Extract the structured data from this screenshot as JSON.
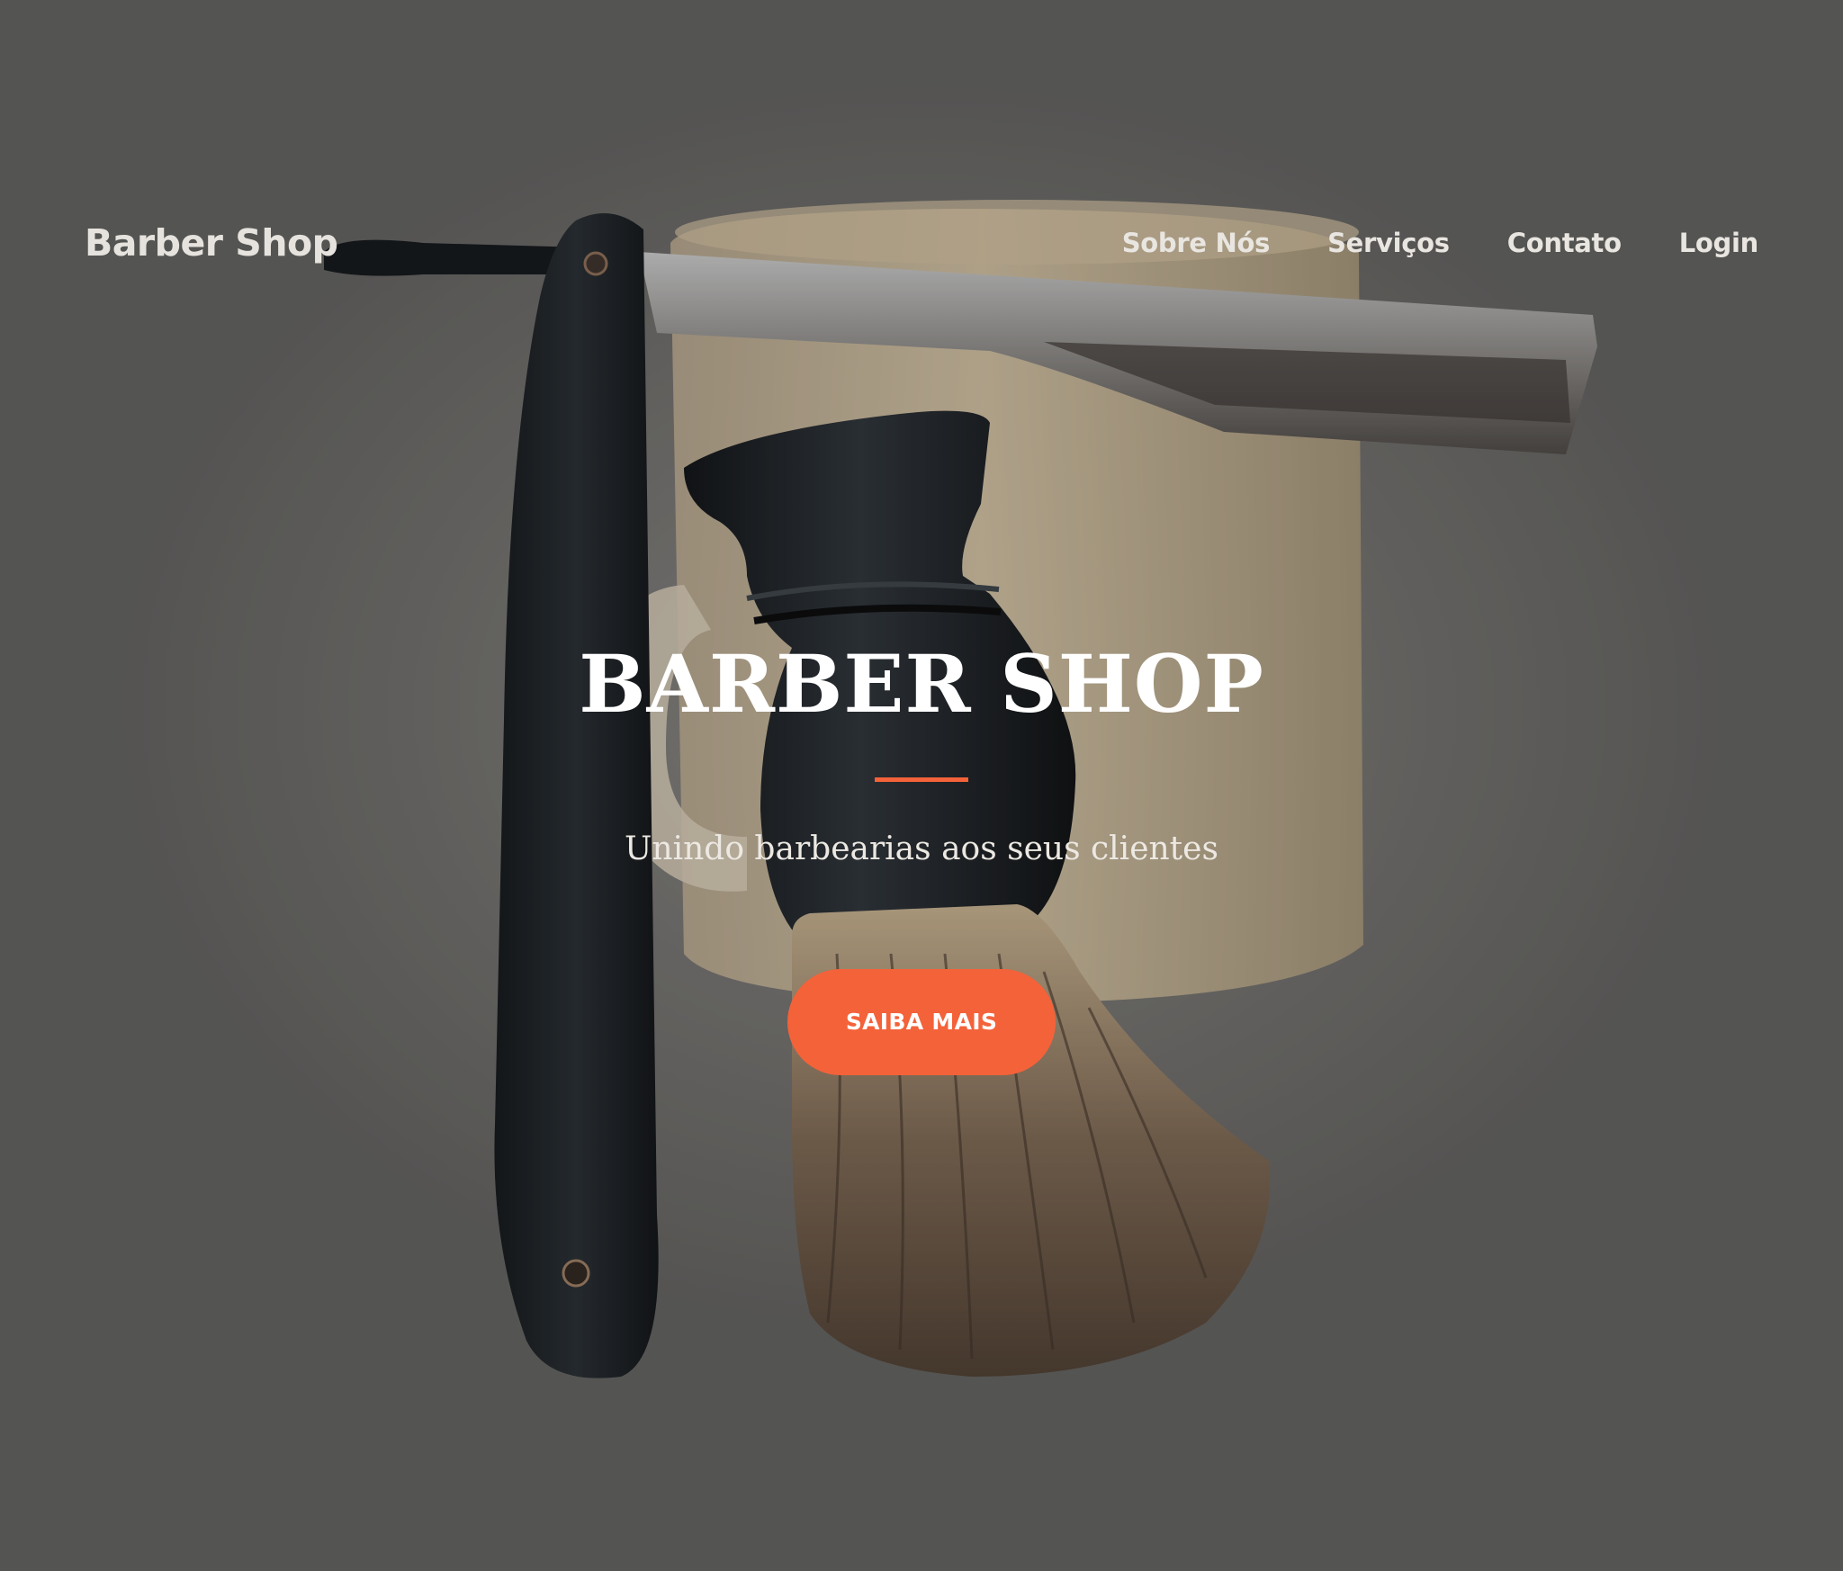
{
  "navbar": {
    "brand": "Barber Shop",
    "links": [
      {
        "label": "Sobre Nós"
      },
      {
        "label": "Serviços"
      },
      {
        "label": "Contato"
      },
      {
        "label": "Login"
      }
    ]
  },
  "masthead": {
    "title": "BARBER SHOP",
    "subtitle": "Unindo barbearias aos seus clientes",
    "cta_label": "SAIBA MAIS"
  },
  "colors": {
    "accent": "#f4623a",
    "overlay": "#5f5e5c",
    "text_light": "#ffffff"
  },
  "background_image": {
    "subject": "straight razor, shaving brush and shaving mug"
  }
}
